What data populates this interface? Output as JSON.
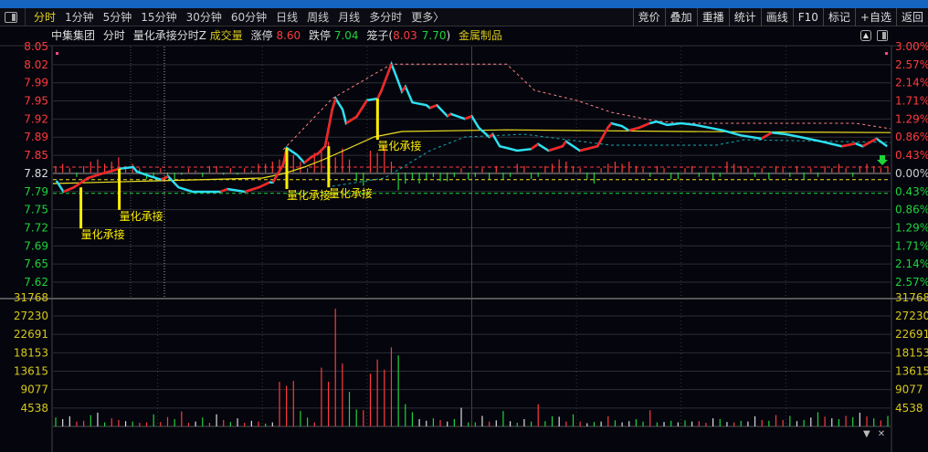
{
  "toolbar": {
    "periods": [
      "分时",
      "1分钟",
      "5分钟",
      "15分钟",
      "30分钟",
      "60分钟",
      "日线",
      "周线",
      "月线",
      "多分时",
      "更多〉"
    ],
    "active_period": "分时",
    "right_buttons": [
      "竞价",
      "叠加",
      "重播",
      "统计",
      "画线",
      "F10",
      "标记",
      "+自选",
      "返回"
    ]
  },
  "info": {
    "stock_name": "中集集团",
    "view": "分时",
    "indicator": "量化承接分时Z",
    "volume_label": "成交量",
    "limit_up_label": "涨停",
    "limit_up": "8.60",
    "limit_down_label": "跌停",
    "limit_down": "7.04",
    "cage_label": "笼子(",
    "cage_high": "8.03",
    "cage_low": "7.70",
    "cage_close": ")",
    "sector": "金属制品"
  },
  "colors": {
    "up": "#ff3b3b",
    "down": "#1fd43a",
    "flat": "#dddddd",
    "axis_yellow": "#d8c81a",
    "price_line": "#2de0f0",
    "avg_line": "#f0e020",
    "signal": "#ffee00"
  },
  "chart_data": [
    {
      "type": "line",
      "title": "分时",
      "xlim": [
        0,
        240
      ],
      "ylim": [
        7.62,
        8.05
      ],
      "prev_close": 7.82,
      "left_ticks": [
        "8.05",
        "8.02",
        "7.99",
        "7.95",
        "7.92",
        "7.89",
        "7.85",
        "7.82",
        "7.79",
        "7.75",
        "7.72",
        "7.69",
        "7.65",
        "7.62"
      ],
      "right_ticks": [
        "3.00%",
        "2.57%",
        "2.14%",
        "1.71%",
        "1.29%",
        "0.86%",
        "0.43%",
        "0.00%",
        "0.43%",
        "0.86%",
        "1.29%",
        "1.71%",
        "2.14%",
        "2.57%"
      ],
      "price": [
        [
          1,
          7.805
        ],
        [
          3,
          7.785
        ],
        [
          6,
          7.793
        ],
        [
          10,
          7.81
        ],
        [
          14,
          7.818
        ],
        [
          19,
          7.827
        ],
        [
          23,
          7.83
        ],
        [
          24,
          7.822
        ],
        [
          27,
          7.815
        ],
        [
          31,
          7.807
        ],
        [
          33,
          7.813
        ],
        [
          36,
          7.793
        ],
        [
          40,
          7.785
        ],
        [
          48,
          7.785
        ],
        [
          50,
          7.79
        ],
        [
          55,
          7.785
        ],
        [
          59,
          7.793
        ],
        [
          62,
          7.802
        ],
        [
          63,
          7.802
        ],
        [
          66,
          7.835
        ],
        [
          67,
          7.865
        ],
        [
          70,
          7.852
        ],
        [
          72,
          7.838
        ],
        [
          74,
          7.848
        ],
        [
          76,
          7.855
        ],
        [
          78,
          7.868
        ],
        [
          80,
          7.935
        ],
        [
          81,
          7.955
        ],
        [
          83,
          7.935
        ],
        [
          84,
          7.91
        ],
        [
          87,
          7.922
        ],
        [
          90,
          7.952
        ],
        [
          93,
          7.955
        ],
        [
          94,
          7.968
        ],
        [
          97,
          8.018
        ],
        [
          98,
          8.002
        ],
        [
          100,
          7.968
        ],
        [
          101,
          7.977
        ],
        [
          103,
          7.948
        ],
        [
          107,
          7.943
        ],
        [
          108,
          7.938
        ],
        [
          110,
          7.943
        ],
        [
          113,
          7.923
        ],
        [
          114,
          7.927
        ],
        [
          118,
          7.918
        ],
        [
          120,
          7.923
        ],
        [
          122,
          7.902
        ],
        [
          125,
          7.885
        ],
        [
          126,
          7.89
        ],
        [
          128,
          7.868
        ],
        [
          130,
          7.865
        ],
        [
          133,
          7.86
        ],
        [
          137,
          7.863
        ],
        [
          139,
          7.872
        ],
        [
          142,
          7.86
        ],
        [
          146,
          7.868
        ],
        [
          147,
          7.877
        ],
        [
          151,
          7.86
        ],
        [
          156,
          7.868
        ],
        [
          159,
          7.902
        ],
        [
          160,
          7.91
        ],
        [
          163,
          7.905
        ],
        [
          165,
          7.897
        ],
        [
          168,
          7.902
        ],
        [
          171,
          7.91
        ],
        [
          173,
          7.913
        ],
        [
          176,
          7.907
        ],
        [
          180,
          7.91
        ],
        [
          184,
          7.907
        ],
        [
          188,
          7.902
        ],
        [
          192,
          7.897
        ],
        [
          197,
          7.888
        ],
        [
          203,
          7.882
        ],
        [
          206,
          7.893
        ],
        [
          210,
          7.89
        ],
        [
          214,
          7.885
        ],
        [
          220,
          7.877
        ],
        [
          226,
          7.868
        ],
        [
          230,
          7.873
        ],
        [
          232,
          7.868
        ],
        [
          236,
          7.882
        ],
        [
          239,
          7.868
        ]
      ],
      "average": [
        [
          0,
          7.8
        ],
        [
          30,
          7.805
        ],
        [
          60,
          7.81
        ],
        [
          66,
          7.818
        ],
        [
          72,
          7.83
        ],
        [
          78,
          7.845
        ],
        [
          85,
          7.865
        ],
        [
          92,
          7.885
        ],
        [
          100,
          7.895
        ],
        [
          130,
          7.898
        ],
        [
          180,
          7.895
        ],
        [
          240,
          7.893
        ]
      ],
      "upper_band": [
        [
          66,
          7.862
        ],
        [
          80,
          7.955
        ],
        [
          97,
          8.018
        ],
        [
          130,
          8.018
        ],
        [
          138,
          7.97
        ],
        [
          150,
          7.952
        ],
        [
          160,
          7.93
        ],
        [
          172,
          7.915
        ],
        [
          180,
          7.91
        ],
        [
          230,
          7.91
        ],
        [
          240,
          7.9
        ]
      ],
      "lower_band": [
        [
          80,
          7.795
        ],
        [
          95,
          7.81
        ],
        [
          108,
          7.86
        ],
        [
          118,
          7.885
        ],
        [
          135,
          7.89
        ],
        [
          160,
          7.87
        ],
        [
          190,
          7.87
        ],
        [
          198,
          7.88
        ],
        [
          240,
          7.875
        ]
      ],
      "ref_lines": [
        {
          "value": 7.83,
          "color": "#ff3b3b"
        },
        {
          "value": 7.807,
          "color": "#f0e020"
        },
        {
          "value": 7.782,
          "color": "#1fd43a"
        }
      ],
      "signals": [
        {
          "t": 8,
          "label": "量化承接"
        },
        {
          "t": 19,
          "label": "量化承接"
        },
        {
          "t": 67,
          "label": "量化承接"
        },
        {
          "t": 79,
          "label": "量化承接"
        },
        {
          "t": 93,
          "label": "量化承接"
        }
      ],
      "osc": [
        0.3,
        0.4,
        0.2,
        -0.2,
        0.3,
        0.5,
        0.6,
        0.4,
        0.5,
        0.7,
        0.3,
        0.4,
        0.2,
        -0.3,
        -0.2,
        0.2,
        -0.2,
        -0.3,
        -0.1,
        0.2,
        0.1,
        -0.2,
        0.3,
        0.3,
        -0.1,
        0.2,
        -0.1,
        0.2,
        0.1,
        0.4,
        0.4,
        0.5,
        0.6,
        0.4,
        0.8,
        0.5,
        0.2,
        0.9,
        1.0,
        1.4,
        0.7,
        1.1,
        0.6,
        -0.4,
        -0.6,
        1.0,
        0.9,
        1.2,
        0.5,
        -0.8,
        -0.5,
        -0.3,
        -0.5,
        -0.3,
        -0.2,
        -0.4,
        -0.4,
        -0.2,
        0.2,
        -0.3,
        -0.2,
        0.2,
        -0.3,
        0.3,
        -0.3,
        -0.2,
        0.4,
        0.3,
        -0.3,
        -0.2,
        0.3,
        0.4,
        0.6,
        0.5,
        0.3,
        0.2,
        -0.3,
        -0.5,
        0.2,
        0.4,
        0.5,
        0.4,
        0.5,
        0.3,
        0.2,
        -0.2,
        0.3,
        0.2,
        -0.3,
        -0.3,
        0.2,
        0.3,
        -0.2,
        0.2,
        -0.3,
        -0.2,
        0.5,
        0.4,
        0.3,
        0.2,
        -0.2,
        0.2,
        -0.3,
        0.3,
        0.2,
        -0.2,
        0.3,
        -0.3,
        0.2,
        -0.2,
        0.3,
        0.2,
        0.4,
        0.2,
        -0.2,
        0.3,
        0.4,
        0.3,
        0.2,
        0.3
      ]
    },
    {
      "type": "bar",
      "title": "成交量",
      "ylim": [
        0,
        31768
      ],
      "ticks": [
        "31768",
        "27230",
        "22691",
        "18153",
        "13615",
        "9077",
        "4538"
      ],
      "volumes": [
        2200,
        1800,
        2500,
        1200,
        1400,
        2800,
        3400,
        1000,
        2000,
        1600,
        1300,
        1200,
        900,
        1000,
        3000,
        1100,
        2300,
        1800,
        3700,
        900,
        1200,
        2200,
        900,
        3000,
        1600,
        1100,
        2000,
        900,
        1400,
        1200,
        700,
        1000,
        11000,
        10000,
        11200,
        3800,
        2200,
        1000,
        14500,
        11000,
        29000,
        15500,
        8500,
        4200,
        4000,
        13000,
        16500,
        14000,
        19500,
        17500,
        5500,
        3500,
        1800,
        1400,
        2000,
        1600,
        1200,
        1800,
        4600,
        1000,
        1000,
        2600,
        1200,
        1500,
        3800,
        1300,
        900,
        1800,
        1200,
        5500,
        1300,
        2500,
        2400,
        1200,
        3000,
        1200,
        800,
        1100,
        1200,
        2500,
        1500,
        1000,
        1300,
        1800,
        1200,
        4000,
        1000,
        1100,
        1400,
        1000,
        1500,
        1200,
        1300,
        900,
        2000,
        1800,
        1100,
        1000,
        1400,
        1200,
        2500,
        1600,
        1400,
        2800,
        1600,
        2600,
        1300,
        1600,
        2200,
        3500,
        2400,
        2000,
        1800,
        2600,
        2300,
        3400,
        2500,
        2000,
        1500,
        2600
      ],
      "volume_colors": "gwwrrgwgrrwgrrgrrgrrwgrwrgwrwrgwrrrggrrrrrggrrrrrgggwwgrwgwggwrwgwgwgrggwrgrwgwrgwwggrgwgwgwrrwgwrgwwrgrrgwgwgrwgrgwrgrgrgrrgw"
    }
  ]
}
